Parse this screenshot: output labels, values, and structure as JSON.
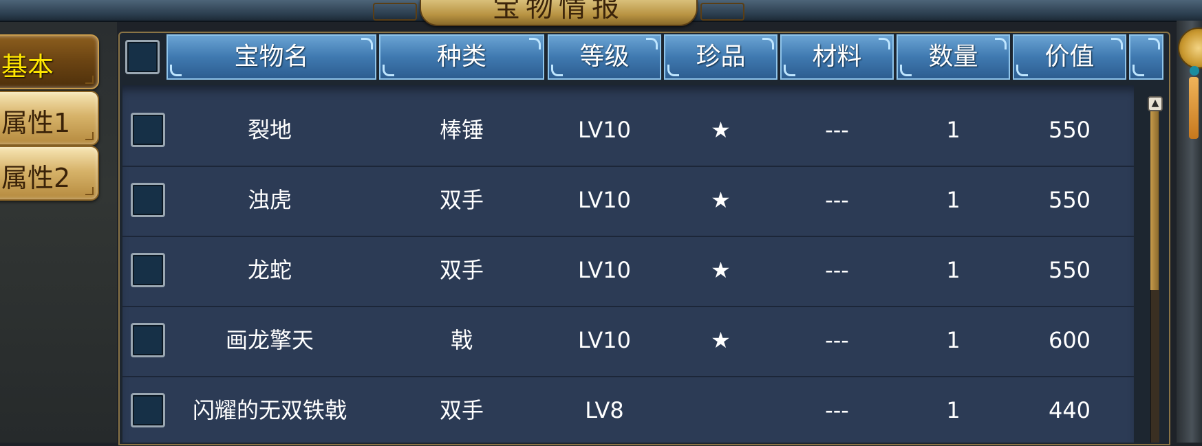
{
  "window": {
    "title": "宝物情报"
  },
  "side_tabs": [
    {
      "label": "基本",
      "active": true
    },
    {
      "label": "属性1",
      "active": false
    },
    {
      "label": "属性2",
      "active": false
    }
  ],
  "table": {
    "columns": [
      "宝物名",
      "种类",
      "等级",
      "珍品",
      "材料",
      "数量",
      "价值"
    ],
    "rows": [
      {
        "name": "裂地",
        "type": "棒锤",
        "level": "LV10",
        "rare": "★",
        "material": "---",
        "quantity": "1",
        "value": "550"
      },
      {
        "name": "浊虎",
        "type": "双手",
        "level": "LV10",
        "rare": "★",
        "material": "---",
        "quantity": "1",
        "value": "550"
      },
      {
        "name": "龙蛇",
        "type": "双手",
        "level": "LV10",
        "rare": "★",
        "material": "---",
        "quantity": "1",
        "value": "550"
      },
      {
        "name": "画龙擎天",
        "type": "戟",
        "level": "LV10",
        "rare": "★",
        "material": "---",
        "quantity": "1",
        "value": "600"
      },
      {
        "name": "闪耀的无双铁戟",
        "type": "双手",
        "level": "LV8",
        "rare": "",
        "material": "---",
        "quantity": "1",
        "value": "440"
      }
    ]
  },
  "scrollbar": {
    "up_icon": "chevron-up-icon",
    "position": 0
  },
  "colors": {
    "header_blue": "#3f79b0",
    "row_bg": "#2c3b55",
    "active_tab_text": "#ffe600",
    "gold": "#c9982f"
  }
}
